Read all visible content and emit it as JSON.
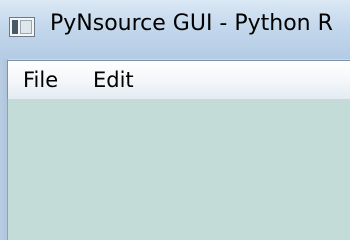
{
  "window": {
    "title": "PyNsource GUI - Python R",
    "icon": "app-window-icon"
  },
  "menubar": {
    "items": [
      {
        "label": "File"
      },
      {
        "label": "Edit"
      }
    ]
  },
  "colors": {
    "titlebar": "#c4d8ec",
    "menubar": "#f3f6fa",
    "canvas": "#c4dcd7"
  }
}
